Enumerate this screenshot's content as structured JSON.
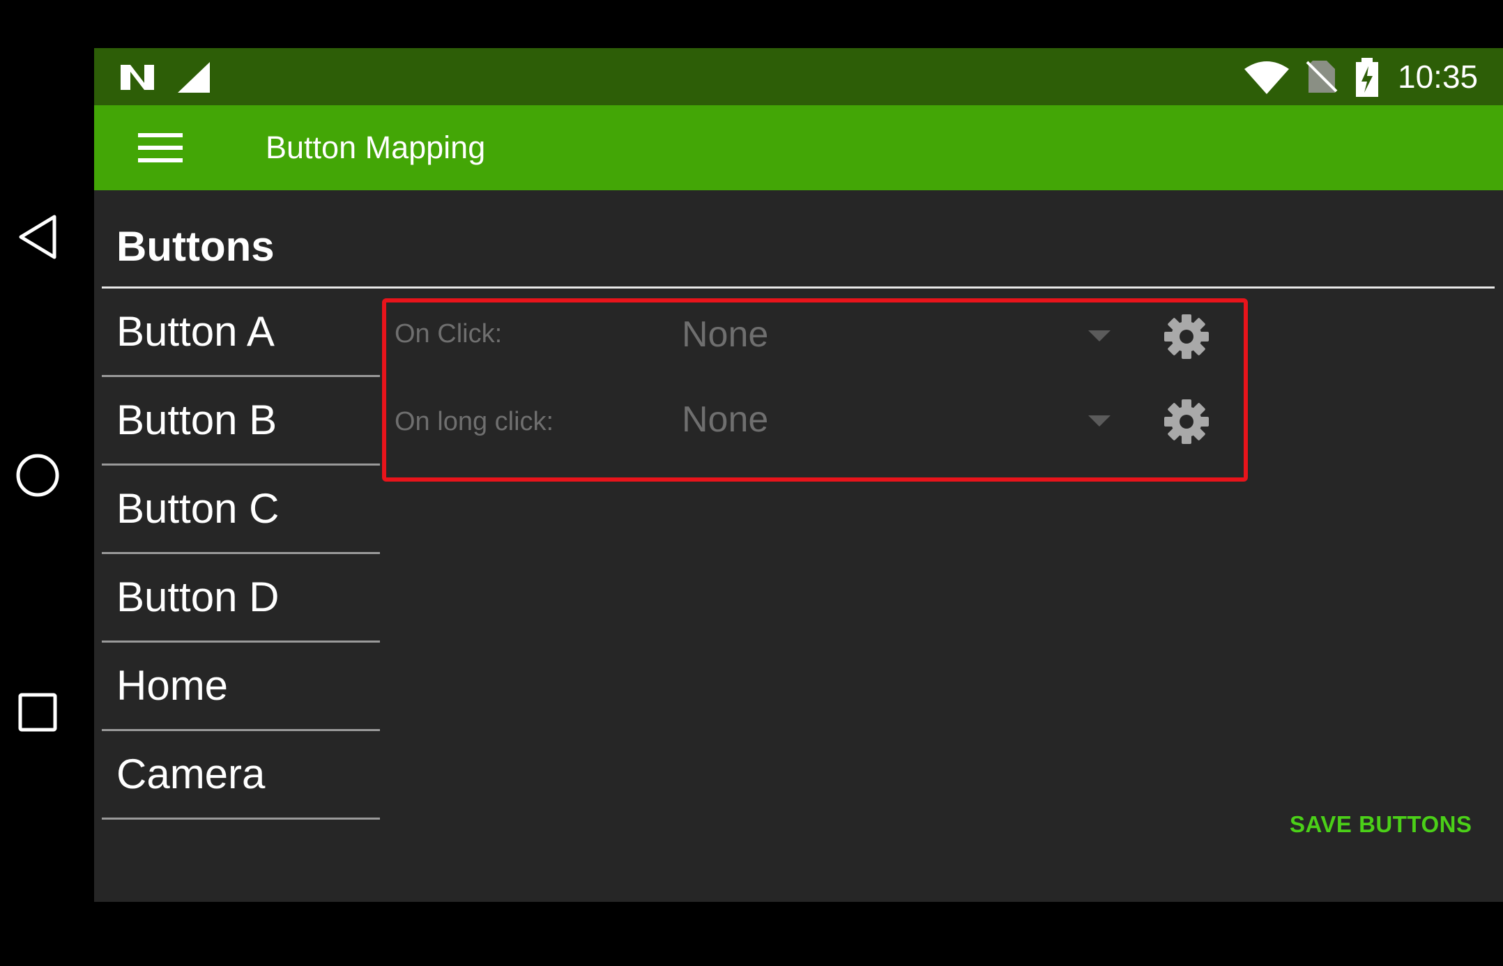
{
  "status_bar": {
    "time": "10:35",
    "icons": [
      "n-logo-icon",
      "cell-signal-icon",
      "wifi-icon",
      "no-sim-icon",
      "battery-charging-icon"
    ]
  },
  "toolbar": {
    "title": "Button Mapping",
    "menu_icon": "hamburger-menu-icon"
  },
  "section": {
    "title": "Buttons"
  },
  "buttons": [
    {
      "label": "Button A"
    },
    {
      "label": "Button B"
    },
    {
      "label": "Button C"
    },
    {
      "label": "Button D"
    },
    {
      "label": "Home"
    },
    {
      "label": "Camera"
    }
  ],
  "actions": {
    "on_click": {
      "label": "On Click:",
      "value": "None"
    },
    "on_long_click": {
      "label": "On long click:",
      "value": "None"
    }
  },
  "save": {
    "label": "SAVE BUTTONS"
  },
  "system_nav": [
    "back-icon",
    "home-icon",
    "recents-icon"
  ],
  "colors": {
    "toolbar": "#43a606",
    "status_bar": "#2d5e07",
    "accent": "#4bd018",
    "highlight": "#e8141b"
  }
}
